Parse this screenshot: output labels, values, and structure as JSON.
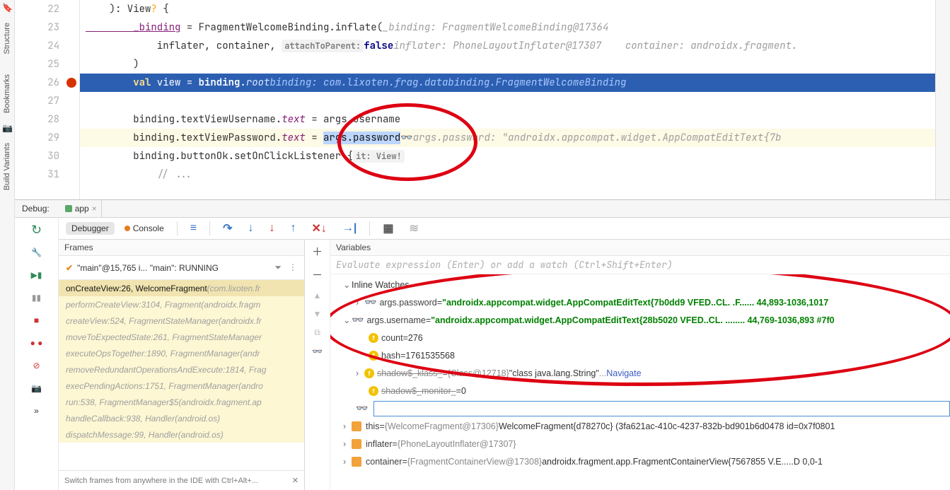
{
  "sidebar": {
    "structure": "Structure",
    "bookmarks": "Bookmarks",
    "buildvariants": "Build Variants"
  },
  "editor": {
    "lines": {
      "l22": {
        "num": "22",
        "a": "    ): View",
        "b": "?",
        "c": " {"
      },
      "l23": {
        "num": "23",
        "a": "        _binding",
        "b": " = FragmentWelcomeBinding.inflate(",
        "hint": "_binding: FragmentWelcomeBinding@17364"
      },
      "l24": {
        "num": "24",
        "a": "            inflater, container, ",
        "ph": "attachToParent:",
        "kw": "false",
        "hint": "inflater: PhoneLayoutInflater@17307    container: androidx.fragment."
      },
      "l25": {
        "num": "25",
        "a": "        )"
      },
      "l26": {
        "num": "26",
        "a": "        ",
        "kw": "val",
        "b": " view = ",
        "prop": "binding",
        "c": ".",
        "prop2": "root",
        "hint": "binding: com.lixoten.frag.databinding.FragmentWelcomeBinding"
      },
      "l27": {
        "num": "27"
      },
      "l28": {
        "num": "28",
        "a": "        binding.textViewUsername.",
        "prop": "text",
        "b": " = args.username"
      },
      "l29": {
        "num": "29",
        "a": "        binding.textViewPassword.",
        "prop": "text",
        "b": " = ",
        "sel": "args.password",
        "glasses": "👓",
        "hint": "args.password: \"androidx.appcompat.widget.AppCompatEditText{7b"
      },
      "l30": {
        "num": "30",
        "a": "        binding.buttonOk.setOnClickListener {",
        "ph": "it: View!"
      },
      "l31": {
        "num": "31",
        "a": "            // ..."
      }
    }
  },
  "debug": {
    "title": "Debug:",
    "runcfg": "app",
    "tabs": {
      "debugger": "Debugger",
      "console": "Console"
    }
  },
  "frames": {
    "title": "Frames",
    "thread": "\"main\"@15,765 i... \"main\": RUNNING",
    "rows": [
      {
        "m": "onCreateView:26, WelcomeFragment ",
        "p": "(com.lixoten.fr"
      },
      {
        "m": "performCreateView:3104, Fragment ",
        "p": "(androidx.fragm"
      },
      {
        "m": "createView:524, FragmentStateManager ",
        "p": "(androidx.fr"
      },
      {
        "m": "moveToExpectedState:261, FragmentStateManager"
      },
      {
        "m": "executeOpsTogether:1890, FragmentManager ",
        "p": "(andr"
      },
      {
        "m": "removeRedundantOperationsAndExecute:1814, Frag"
      },
      {
        "m": "execPendingActions:1751, FragmentManager ",
        "p": "(andro"
      },
      {
        "m": "run:538, FragmentManager$5 ",
        "p": "(androidx.fragment.ap"
      },
      {
        "m": "handleCallback:938, Handler ",
        "p": "(android.os)"
      },
      {
        "m": "dispatchMessage:99, Handler ",
        "p": "(android.os)"
      }
    ],
    "tip": "Switch frames from anywhere in the IDE with Ctrl+Alt+..."
  },
  "variables": {
    "title": "Variables",
    "evalhint": "Evaluate expression (Enter) or add a watch (Ctrl+Shift+Enter)",
    "watches_label": "Inline Watches",
    "w1": {
      "name": "args.password",
      "val": "\"androidx.appcompat.widget.AppCompatEditText{7b0dd9 VFED..CL. .F...... 44,893-1036,1017 "
    },
    "w2": {
      "name": "args.username",
      "val": "\"androidx.appcompat.widget.AppCompatEditText{28b5020 VFED..CL. ........ 44,769-1036,893 #7f0"
    },
    "count": {
      "name": "count",
      "val": "276"
    },
    "hash": {
      "name": "hash",
      "val": "1761535568"
    },
    "sklass": {
      "name": "shadow$_klass_",
      "val": "{Class@12718}",
      "str": "\"class java.lang.String\"",
      "nav": "Navigate"
    },
    "smonitor": {
      "name": "shadow$_monitor_",
      "val": "0"
    },
    "this": {
      "name": "this",
      "val": "{WelcomeFragment@17306}",
      "str": "WelcomeFragment{d78270c} (3fa621ac-410c-4237-832b-bd901b6d0478 id=0x7f0801"
    },
    "inflater": {
      "name": "inflater",
      "val": "{PhoneLayoutInflater@17307}"
    },
    "container": {
      "name": "container",
      "val": "{FragmentContainerView@17308}",
      "str": "androidx.fragment.app.FragmentContainerView{7567855 V.E.....D 0,0-1"
    }
  },
  "status": "D 0,0-1"
}
